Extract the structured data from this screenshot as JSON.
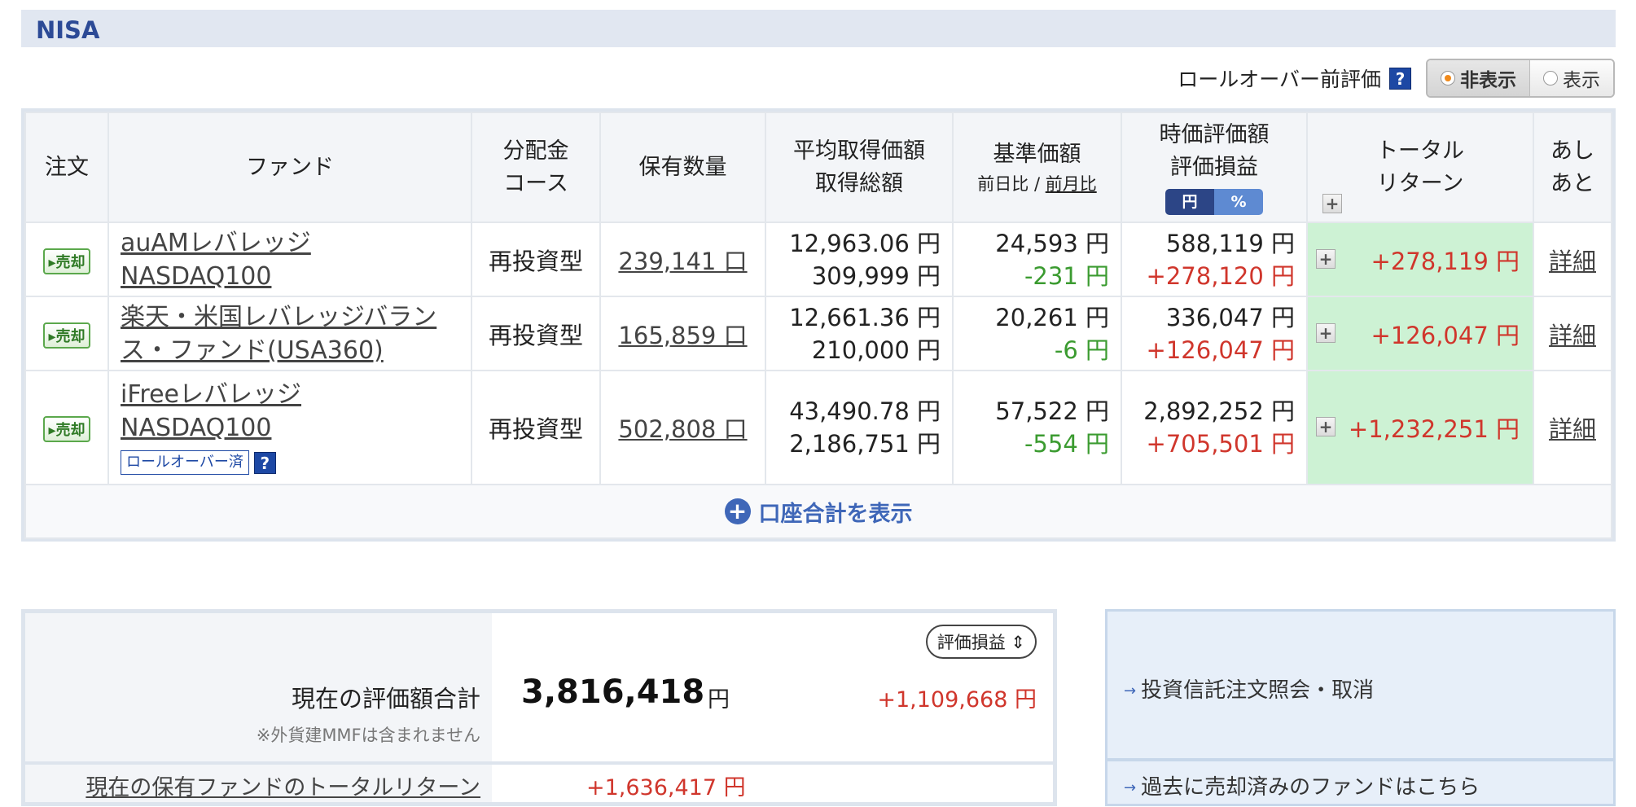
{
  "section_title": "NISA",
  "rollover": {
    "label": "ロールオーバー前評価",
    "help_icon": "?",
    "options": [
      "非表示",
      "表示"
    ],
    "selected": "非表示"
  },
  "table": {
    "headers": {
      "order": "注文",
      "fund": "ファンド",
      "course_l1": "分配金",
      "course_l2": "コース",
      "qty": "保有数量",
      "avg_l1": "平均取得価額",
      "avg_l2": "取得総額",
      "base_l1": "基準価額",
      "base_sub1": "前日比",
      "base_sep": " / ",
      "base_sub2": "前月比",
      "val_l1": "時価評価額",
      "val_l2": "評価損益",
      "unit_yen": "円",
      "unit_pct": "%",
      "ret_l1": "トータル",
      "ret_l2": "リターン",
      "detail_l1": "あし",
      "detail_l2": "あと"
    },
    "rows": [
      {
        "order": "売却",
        "fund_l1": "auAMレバレッジ",
        "fund_l2": "NASDAQ100",
        "course": "再投資型",
        "qty": "239,141 口",
        "avg_price": "12,963.06 円",
        "avg_total": "309,999 円",
        "base_price": "24,593 円",
        "base_change": "-231 円",
        "value": "588,119 円",
        "gain": "+278,120 円",
        "total_return": "+278,119 円",
        "detail": "詳細"
      },
      {
        "order": "売却",
        "fund_l1": "楽天・米国レバレッジバラン",
        "fund_l2": "ス・ファンド(USA360)",
        "course": "再投資型",
        "qty": "165,859 口",
        "avg_price": "12,661.36 円",
        "avg_total": "210,000 円",
        "base_price": "20,261 円",
        "base_change": "-6 円",
        "value": "336,047 円",
        "gain": "+126,047 円",
        "total_return": "+126,047 円",
        "detail": "詳細"
      },
      {
        "order": "売却",
        "fund_l1": "iFreeレバレッジ",
        "fund_l2": "NASDAQ100",
        "rollover_tag": "ロールオーバー済",
        "course": "再投資型",
        "qty": "502,808 口",
        "avg_price": "43,490.78 円",
        "avg_total": "2,186,751 円",
        "base_price": "57,522 円",
        "base_change": "-554 円",
        "value": "2,892,252 円",
        "gain": "+705,501 円",
        "total_return": "+1,232,251 円",
        "detail": "詳細"
      }
    ],
    "footer_link": "口座合計を表示"
  },
  "summary": {
    "label": "現在の評価額合計",
    "note": "※外貨建MMFは含まれません",
    "select_label": "評価損益",
    "total": "3,816,418",
    "unit": "円",
    "diff": "+1,109,668 円",
    "total_return_label": "現在の保有ファンドのトータルリターン",
    "total_return_value": "+1,636,417 円"
  },
  "links": {
    "order_inquiry": "投資信託注文照会・取消",
    "sold_funds": "過去に売却済みのファンドはこちら"
  },
  "colors": {
    "brand_blue": "#2c4a96",
    "positive_red": "#d0362c",
    "negative_green": "#3b9b30",
    "return_bg": "#cdf2d4"
  }
}
